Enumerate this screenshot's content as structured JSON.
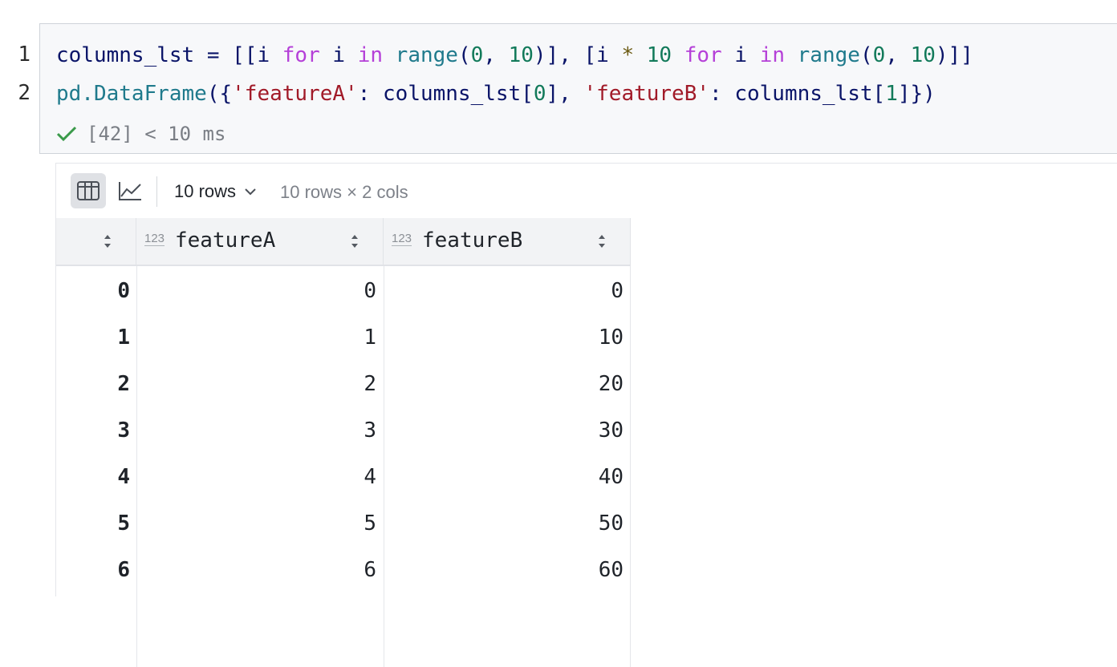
{
  "editor": {
    "line_numbers": [
      "1",
      "2"
    ],
    "line1": {
      "t1": "columns_lst = [[i ",
      "kw_for": "for",
      "t2": " i ",
      "kw_in": "in",
      "t3": " ",
      "fn_range": "range",
      "t4": "(",
      "n0": "0",
      "t5": ", ",
      "n10": "10",
      "t6": ")], [i ",
      "op": "*",
      "t7": " ",
      "n10b": "10",
      "t8": " ",
      "kw_for2": "for",
      "t9": " i ",
      "kw_in2": "in",
      "t10": " ",
      "fn_range2": "range",
      "t11": "(",
      "n0b": "0",
      "t12": ", ",
      "n10c": "10",
      "t13": ")]]"
    },
    "line2": {
      "fn_pd": "pd.DataFrame",
      "t1": "({",
      "s1": "'featureA'",
      "t2": ": columns_lst[",
      "n0": "0",
      "t3": "], ",
      "s2": "'featureB'",
      "t4": ": columns_lst[",
      "n1": "1",
      "t5": "]})"
    },
    "status": "[42] < 10 ms"
  },
  "output": {
    "toolbar": {
      "rows_label": "10 rows",
      "shape": "10 rows × 2 cols"
    },
    "table": {
      "columns": [
        "featureA",
        "featureB"
      ],
      "type_badge": "123",
      "rows": [
        {
          "index": "0",
          "featureA": "0",
          "featureB": "0"
        },
        {
          "index": "1",
          "featureA": "1",
          "featureB": "10"
        },
        {
          "index": "2",
          "featureA": "2",
          "featureB": "20"
        },
        {
          "index": "3",
          "featureA": "3",
          "featureB": "30"
        },
        {
          "index": "4",
          "featureA": "4",
          "featureB": "40"
        },
        {
          "index": "5",
          "featureA": "5",
          "featureB": "50"
        },
        {
          "index": "6",
          "featureA": "6",
          "featureB": "60"
        }
      ]
    }
  },
  "colors": {
    "keyword": "#b540d8",
    "number": "#127a5a",
    "function": "#1f7a8c",
    "string": "#a11a28",
    "success": "#3a9a4a"
  }
}
